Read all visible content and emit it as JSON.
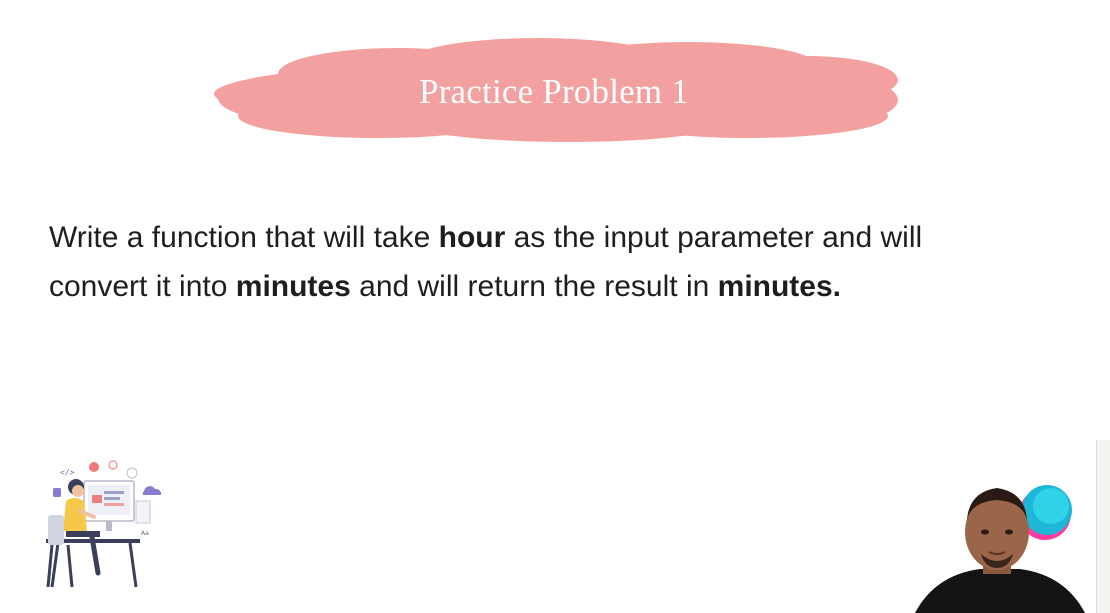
{
  "slide": {
    "title": "Practice Problem 1",
    "problem": {
      "line1": {
        "before": "Write a function that will take ",
        "bold": "hour",
        "after": " as the input parameter and will"
      },
      "line2": {
        "before": "convert it into ",
        "bold1": "minutes",
        "middle": " and will return the result in ",
        "bold2": "minutes."
      }
    }
  },
  "colors": {
    "cloud": "#f2a1a0",
    "title_text": "#ffffff",
    "body_text": "#1e1e1e",
    "background": "#ffffff"
  },
  "icons": {
    "illustration": "developer-at-desk-illustration",
    "presenter": "presenter-webcam",
    "logo": "teal-pink-logo"
  }
}
